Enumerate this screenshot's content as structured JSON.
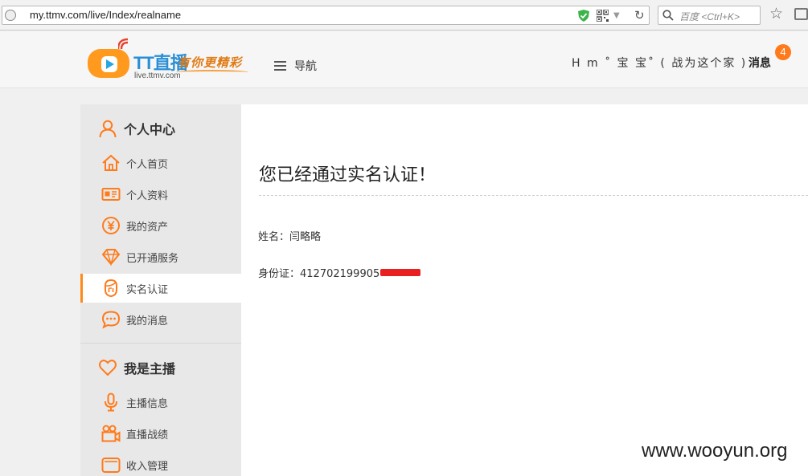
{
  "browser": {
    "url": "my.ttmv.com/live/Index/realname",
    "search_placeholder": "百度 <Ctrl+K>"
  },
  "header": {
    "logo_title": "TT直播",
    "logo_url": "live.ttmv.com",
    "logo_slogan": "有你更精彩",
    "nav_label": "导航",
    "user_name": "H m ˚ 宝 宝˚ ( 战为这个家 )",
    "messages_label": "消息",
    "messages_count": "4"
  },
  "sidebar": {
    "section_personal": "个人中心",
    "personal_items": [
      {
        "label": "个人首页",
        "icon": "home-icon"
      },
      {
        "label": "个人资料",
        "icon": "id-card-icon"
      },
      {
        "label": "我的资产",
        "icon": "yen-coin-icon"
      },
      {
        "label": "已开通服务",
        "icon": "diamond-icon"
      },
      {
        "label": "实名认证",
        "icon": "face-id-icon",
        "active": true
      },
      {
        "label": "我的消息",
        "icon": "chat-bubble-icon"
      }
    ],
    "section_anchor": "我是主播",
    "anchor_items": [
      {
        "label": "主播信息",
        "icon": "microphone-icon"
      },
      {
        "label": "直播战绩",
        "icon": "video-camera-icon"
      },
      {
        "label": "收入管理",
        "icon": "wallet-icon"
      }
    ]
  },
  "main": {
    "title": "您已经通过实名认证！",
    "name_label": "姓名：闫略略",
    "id_label": "身份证：412702199905"
  },
  "watermark": "www.wooyun.org",
  "colors": {
    "accent": "#ff8a1a",
    "badge": "#ff7a1a",
    "logo_blue": "#2a8fd6",
    "redaction": "#e82020"
  }
}
